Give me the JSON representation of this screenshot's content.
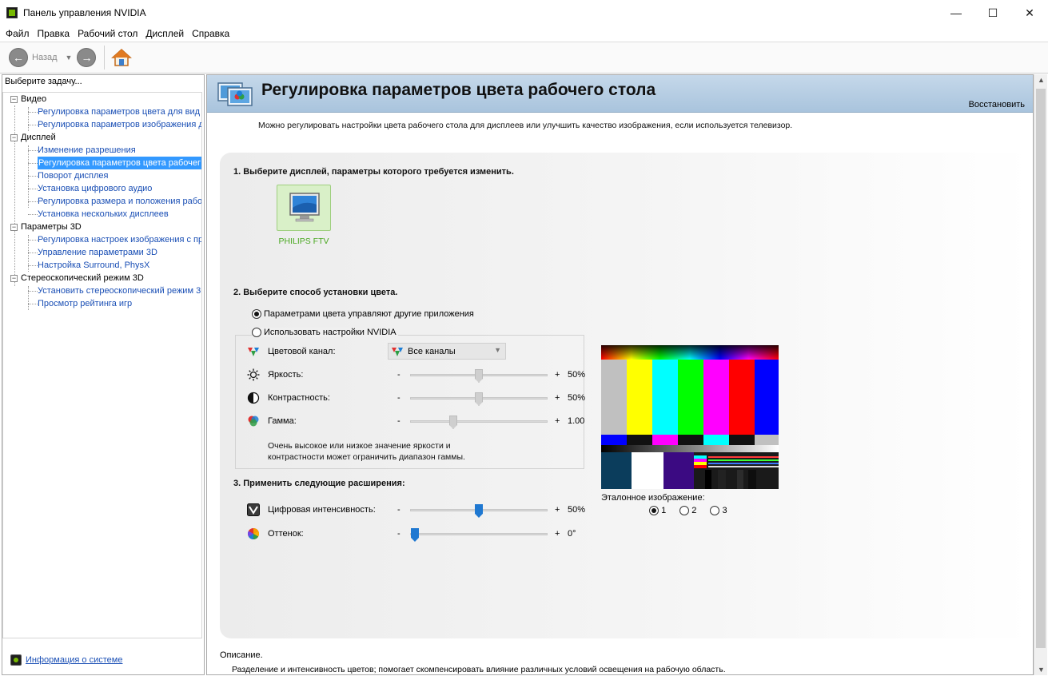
{
  "window": {
    "title": "Панель управления NVIDIA",
    "minimize": "—",
    "maximize": "☐",
    "close": "✕"
  },
  "menu": [
    "Файл",
    "Правка",
    "Рабочий стол",
    "Дисплей",
    "Справка"
  ],
  "toolbar": {
    "back_label": "Назад"
  },
  "sidebar": {
    "header": "Выберите задачу...",
    "tree": [
      {
        "label": "Видео",
        "children": [
          "Регулировка параметров цвета для вид",
          "Регулировка параметров изображения д"
        ]
      },
      {
        "label": "Дисплей",
        "children": [
          "Изменение разрешения",
          "Регулировка параметров цвета рабочег",
          "Поворот дисплея",
          "Установка цифрового аудио",
          "Регулировка размера и положения рабо",
          "Установка нескольких дисплеев"
        ]
      },
      {
        "label": "Параметры 3D",
        "children": [
          "Регулировка настроек изображения с пр",
          "Управление параметрами 3D",
          "Настройка Surround, PhysX"
        ]
      },
      {
        "label": "Стереоскопический режим 3D",
        "children": [
          "Установить стереоскопический режим 3",
          "Просмотр рейтинга игр"
        ]
      }
    ],
    "selected": "Регулировка параметров цвета рабочег",
    "system_info": "Информация о системе"
  },
  "page": {
    "title": "Регулировка параметров цвета рабочего стола",
    "restore": "Восстановить",
    "intro": "Можно регулировать настройки цвета рабочего стола для дисплеев или улучшить качество изображения, если используется телевизор.",
    "step1": "1. Выберите дисплей, параметры которого требуется изменить.",
    "display_name": "PHILIPS FTV",
    "step2": "2. Выберите способ установки цвета.",
    "radio_other_apps": "Параметрами цвета управляют другие приложения",
    "radio_nvidia": "Использовать настройки NVIDIA",
    "color_channel_label": "Цветовой канал:",
    "color_channel_value": "Все каналы",
    "brightness_label": "Яркость:",
    "brightness_value": "50%",
    "brightness_level": 50,
    "contrast_label": "Контрастность:",
    "contrast_value": "50%",
    "contrast_level": 50,
    "gamma_label": "Гамма:",
    "gamma_value": "1.00",
    "gamma_level": 30,
    "minus": "-",
    "plus": "+",
    "note_line1": "Очень высокое или низкое значение яркости и",
    "note_line2": "контрастности может ограничить диапазон гаммы.",
    "step3": "3. Применить следующие расширения:",
    "digital_vibrance_label": "Цифровая интенсивность:",
    "digital_vibrance_value": "50%",
    "digital_vibrance_level": 50,
    "hue_label": "Оттенок:",
    "hue_value": "0°",
    "hue_level": 0,
    "reference_label": "Эталонное изображение:",
    "reference_options": [
      "1",
      "2",
      "3"
    ],
    "description_title": "Описание.",
    "description_text": "Разделение и интенсивность цветов; помогает скомпенсировать влияние различных условий освещения на рабочую область."
  },
  "colors": {
    "link": "#1a4fb5",
    "selection": "#3399ff",
    "nvidia_green": "#76b900",
    "slider_blue": "#1f78d1"
  }
}
